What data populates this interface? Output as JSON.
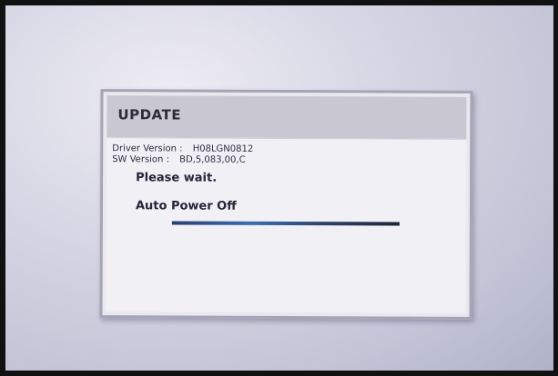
{
  "dialog": {
    "title": "UPDATE",
    "driver_version_label": "Driver Version :",
    "driver_version_value": "H08LGN0812",
    "sw_version_label": "SW Version :",
    "sw_version_value": "BD,5,083,00,C",
    "message_wait": "Please wait.",
    "message_power": "Auto Power Off",
    "progress_fraction": 1.0
  },
  "colors": {
    "screen_background": "#d6d6e4",
    "dialog_background": "#e9e8ef",
    "title_bar": "#c9c7d2",
    "progress_bar": "#3a6fb0"
  }
}
